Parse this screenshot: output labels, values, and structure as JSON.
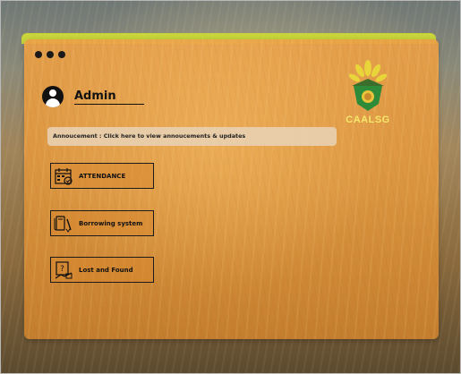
{
  "window": {
    "controls": [
      "dot",
      "dot",
      "dot"
    ]
  },
  "user": {
    "name": "Admin",
    "icon": "user-avatar-icon"
  },
  "logo": {
    "text": "CAALSG",
    "colors": {
      "leaves": "#e9d43a",
      "shield": "#2e8b3a",
      "text": "#f6e86a"
    }
  },
  "announcement": {
    "text": "Annoucement : Click here to view annoucements & updates"
  },
  "menu": [
    {
      "label": "ATTENDANCE",
      "icon": "calendar-icon"
    },
    {
      "label": "Borrowing system",
      "icon": "book-pen-icon"
    },
    {
      "label": "Lost and Found",
      "icon": "lost-found-icon"
    }
  ],
  "colors": {
    "accent": "#c8d43a",
    "panel": "#e39a45"
  }
}
